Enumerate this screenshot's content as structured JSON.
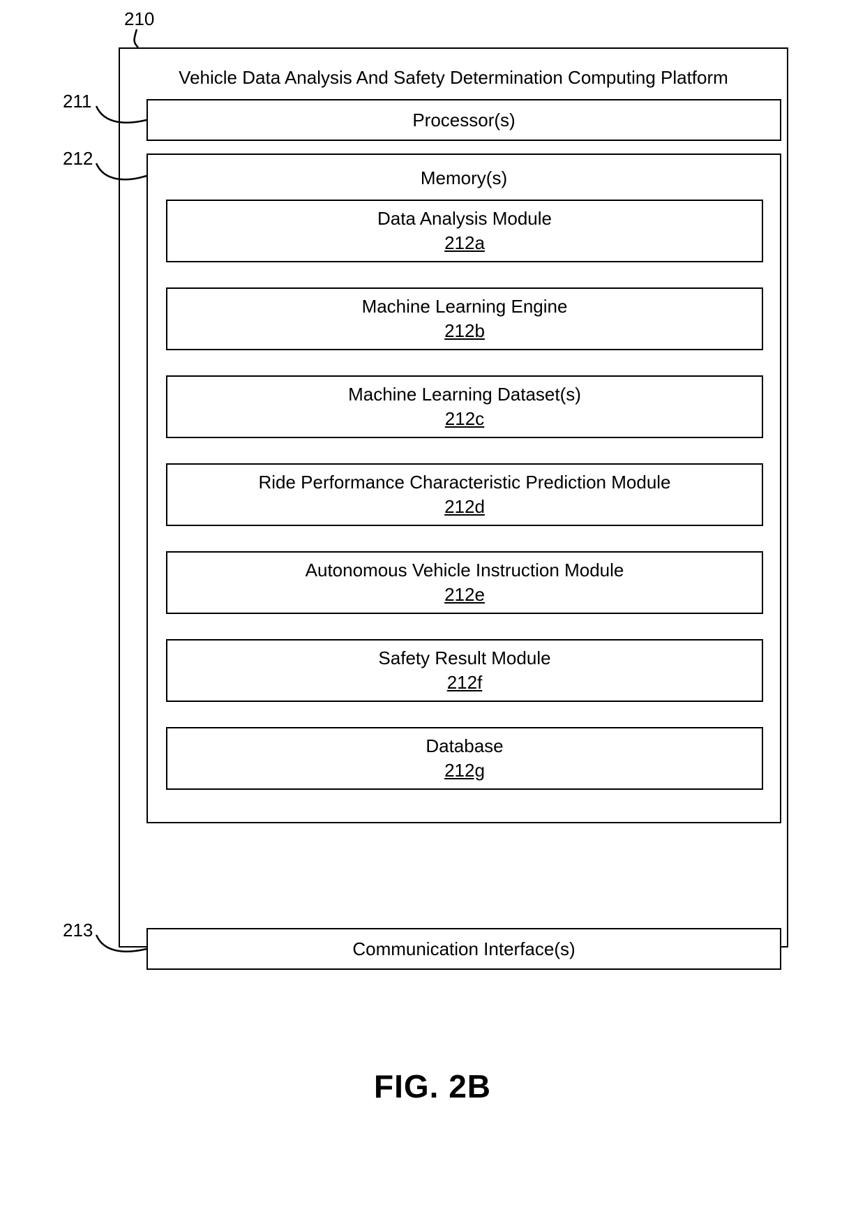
{
  "labels": {
    "ref_210": "210",
    "ref_211": "211",
    "ref_212": "212",
    "ref_213": "213"
  },
  "platform": {
    "title": "Vehicle Data Analysis And Safety Determination Computing Platform",
    "processors": "Processor(s)",
    "comm_interface": "Communication Interface(s)"
  },
  "memory": {
    "title": "Memory(s)",
    "modules": [
      {
        "name": "Data Analysis Module",
        "ref": "212a"
      },
      {
        "name": "Machine Learning Engine",
        "ref": "212b"
      },
      {
        "name": "Machine Learning Dataset(s)",
        "ref": "212c"
      },
      {
        "name": "Ride Performance Characteristic Prediction Module",
        "ref": "212d"
      },
      {
        "name": "Autonomous Vehicle Instruction Module",
        "ref": "212e"
      },
      {
        "name": "Safety Result Module",
        "ref": "212f"
      },
      {
        "name": "Database",
        "ref": "212g"
      }
    ]
  },
  "figure_caption": "FIG. 2B"
}
